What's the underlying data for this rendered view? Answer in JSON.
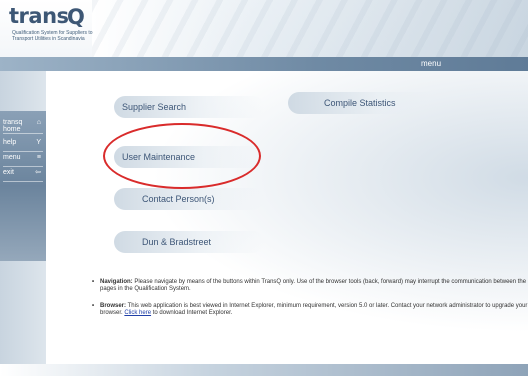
{
  "header": {
    "logo_word": "trans",
    "logo_mark": "Q",
    "logo_subtitle": "Qualification System for Suppliers to Transport Utilities in Scandinavia"
  },
  "menubar": {
    "label": "menu"
  },
  "sidebar": {
    "items": [
      {
        "label": "transq home",
        "icon": "home-icon",
        "glyph": "⌂"
      },
      {
        "label": "help",
        "icon": "help-icon",
        "glyph": "Y"
      },
      {
        "label": "menu",
        "icon": "menu-icon",
        "glyph": "≡"
      },
      {
        "label": "exit",
        "icon": "exit-icon",
        "glyph": "⇦"
      }
    ]
  },
  "main": {
    "buttons": {
      "supplier_search": "Supplier Search",
      "compile_statistics": "Compile Statistics",
      "user_maintenance": "User Maintenance",
      "contact_persons": "Contact Person(s)",
      "dun_bradstreet": "Dun & Bradstreet"
    }
  },
  "notes": {
    "navigation_title": "Navigation:",
    "navigation_text": "Please navigate by means of the buttons within TransQ only. Use of the browser tools (back, forward) may interrupt the communication between the pages in the Qualification System.",
    "browser_title": "Browser:",
    "browser_text": "This web application is best viewed in Internet Explorer, minimum requirement, version 5.0 or later. Contact your network administrator to upgrade your browser.",
    "click_here": "Click here",
    "browser_tail": "to download Internet Explorer."
  },
  "colors": {
    "brand": "#3d5775",
    "menubar": "#6f8aa4",
    "highlight": "#d92b2b",
    "link": "#1f3fa8"
  }
}
